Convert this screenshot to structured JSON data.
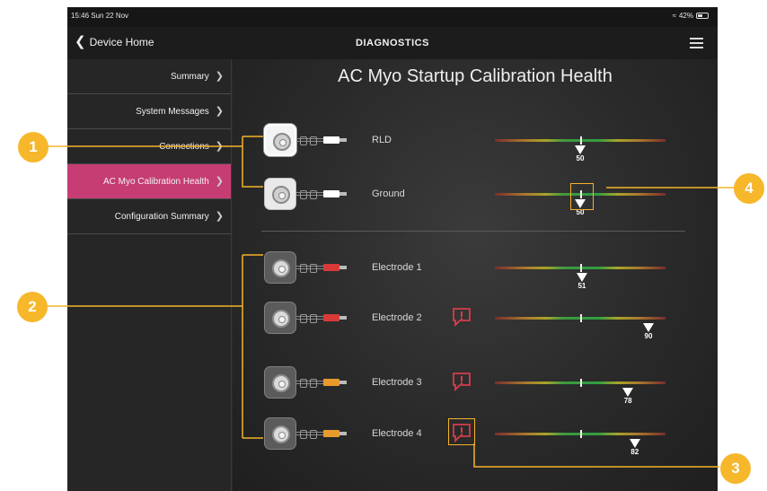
{
  "status": {
    "time": "15:46  Sun 22 Nov",
    "battery": "42%"
  },
  "nav": {
    "back_label": "Device Home",
    "title": "DIAGNOSTICS"
  },
  "sidebar": {
    "items": [
      {
        "label": "Summary"
      },
      {
        "label": "System Messages"
      },
      {
        "label": "Connections"
      },
      {
        "label": "AC Myo Calibration Health"
      },
      {
        "label": "Configuration Summary"
      }
    ],
    "active_index": 3
  },
  "main": {
    "title": "AC Myo Startup Calibration Health",
    "rows": [
      {
        "label": "RLD",
        "value": 50,
        "plug_color": "#ffffff",
        "warning": false
      },
      {
        "label": "Ground",
        "value": 50,
        "plug_color": "#ffffff",
        "warning": false
      },
      {
        "label": "Electrode 1",
        "value": 51,
        "plug_color": "#d83a3a",
        "warning": false
      },
      {
        "label": "Electrode 2",
        "value": 90,
        "plug_color": "#d83a3a",
        "warning": true
      },
      {
        "label": "Electrode 3",
        "value": 78,
        "plug_color": "#e99a2c",
        "warning": true
      },
      {
        "label": "Electrode 4",
        "value": 82,
        "plug_color": "#e99a2c",
        "warning": true
      }
    ]
  },
  "callouts": [
    "1",
    "2",
    "3",
    "4"
  ],
  "colors": {
    "accent": "#c53d73",
    "callout": "#f6b72b",
    "warning": "#d63d4b"
  }
}
